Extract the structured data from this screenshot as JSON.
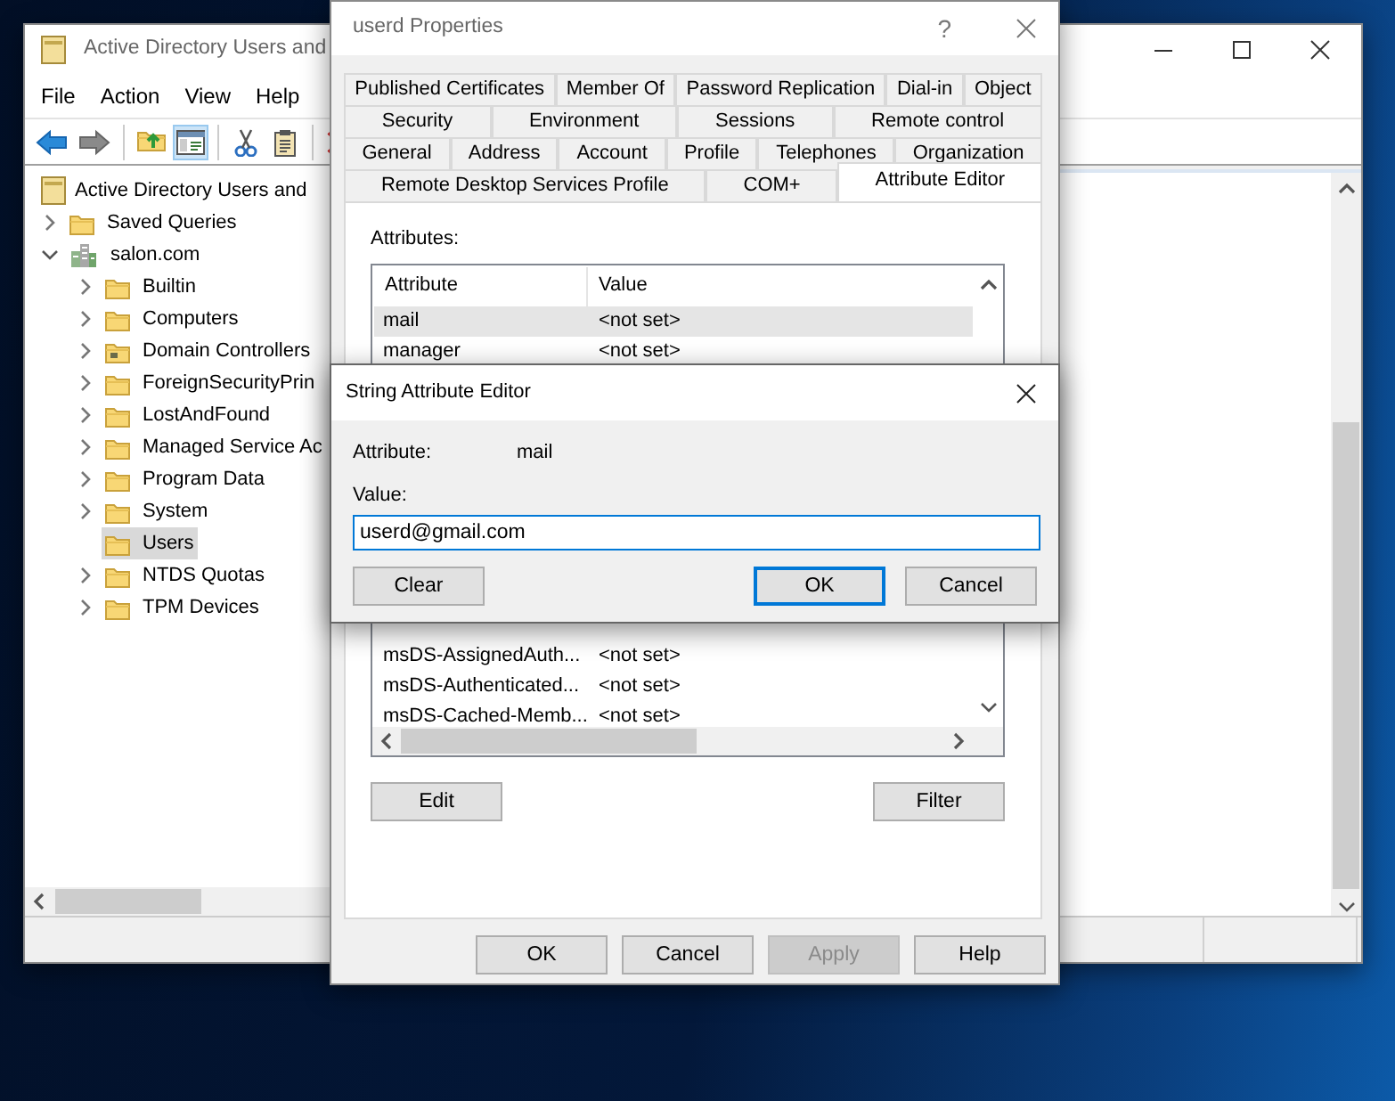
{
  "main_window": {
    "title": "Active Directory Users and",
    "menu": [
      "File",
      "Action",
      "View",
      "Help"
    ],
    "toolbar": [
      {
        "kind": "back",
        "pressed": false
      },
      {
        "kind": "forward",
        "pressed": false
      },
      {
        "kind": "separator"
      },
      {
        "kind": "up",
        "pressed": false
      },
      {
        "kind": "console_tree",
        "pressed": true
      },
      {
        "kind": "separator"
      },
      {
        "kind": "cut",
        "pressed": false
      },
      {
        "kind": "paste",
        "pressed": false
      },
      {
        "kind": "separator"
      },
      {
        "kind": "delete"
      }
    ],
    "tree": {
      "label": "Active Directory Users and",
      "kind": "snapin",
      "selected": false,
      "children": [
        {
          "label": "Saved Queries",
          "kind": "folder",
          "expanded": false,
          "selected": false
        },
        {
          "label": "salon.com",
          "kind": "domain",
          "expanded": true,
          "selected": false,
          "children": [
            {
              "label": "Builtin",
              "kind": "folder",
              "expanded": false,
              "selected": false
            },
            {
              "label": "Computers",
              "kind": "folder",
              "expanded": false,
              "selected": false
            },
            {
              "label": "Domain Controllers",
              "kind": "ou",
              "expanded": false,
              "selected": false
            },
            {
              "label": "ForeignSecurityPrin",
              "kind": "folder",
              "expanded": false,
              "selected": false
            },
            {
              "label": "LostAndFound",
              "kind": "folder",
              "expanded": false,
              "selected": false
            },
            {
              "label": "Managed Service Ac",
              "kind": "folder",
              "expanded": false,
              "selected": false
            },
            {
              "label": "Program Data",
              "kind": "folder",
              "expanded": false,
              "selected": false
            },
            {
              "label": "System",
              "kind": "folder",
              "expanded": false,
              "selected": false
            },
            {
              "label": "Users",
              "kind": "folder",
              "selected": true
            },
            {
              "label": "NTDS Quotas",
              "kind": "folder",
              "expanded": false,
              "selected": false
            },
            {
              "label": "TPM Devices",
              "kind": "folder",
              "expanded": false,
              "selected": false
            }
          ]
        }
      ]
    }
  },
  "properties_dialog": {
    "title": "userd Properties",
    "help_button": "?",
    "tab_rows": [
      [
        {
          "label": "Published Certificates",
          "selected": false
        },
        {
          "label": "Member Of",
          "selected": false
        },
        {
          "label": "Password Replication",
          "selected": false
        },
        {
          "label": "Dial-in",
          "selected": false
        },
        {
          "label": "Object",
          "selected": false
        }
      ],
      [
        {
          "label": "Security",
          "selected": false
        },
        {
          "label": "Environment",
          "selected": false
        },
        {
          "label": "Sessions",
          "selected": false
        },
        {
          "label": "Remote control",
          "selected": false
        }
      ],
      [
        {
          "label": "General",
          "selected": false
        },
        {
          "label": "Address",
          "selected": false
        },
        {
          "label": "Account",
          "selected": false
        },
        {
          "label": "Profile",
          "selected": false
        },
        {
          "label": "Telephones",
          "selected": false
        },
        {
          "label": "Organization",
          "selected": false
        }
      ],
      [
        {
          "label": "Remote Desktop Services Profile",
          "selected": false
        },
        {
          "label": "COM+",
          "selected": false
        },
        {
          "label": "Attribute Editor",
          "selected": true
        }
      ]
    ],
    "attributes_label": "Attributes:",
    "columns": [
      "Attribute",
      "Value"
    ],
    "rows_above_editor": [
      {
        "attribute": "mail",
        "value": "<not set>",
        "selected": true
      },
      {
        "attribute": "manager",
        "value": "<not set>",
        "selected": false
      }
    ],
    "rows_below_editor": [
      {
        "attribute": "msDS-AssignedAuth...",
        "value": "<not set>",
        "selected": false
      },
      {
        "attribute": "msDS-Authenticated...",
        "value": "<not set>",
        "selected": false
      },
      {
        "attribute": "msDS-Cached-Memb...",
        "value": "<not set>",
        "selected": false
      }
    ],
    "list_buttons": [
      "Edit",
      "Filter"
    ],
    "buttons": [
      {
        "label": "OK",
        "disabled": false
      },
      {
        "label": "Cancel",
        "disabled": false
      },
      {
        "label": "Apply",
        "disabled": true
      },
      {
        "label": "Help",
        "disabled": false
      }
    ]
  },
  "editor_dialog": {
    "title": "String Attribute Editor",
    "attribute_label": "Attribute:",
    "attribute": "mail",
    "value_label": "Value:",
    "value": "userd@gmail.com",
    "buttons": [
      {
        "label": "Clear",
        "default": false
      },
      {
        "label": "OK",
        "default": true
      },
      {
        "label": "Cancel",
        "default": false
      }
    ]
  }
}
